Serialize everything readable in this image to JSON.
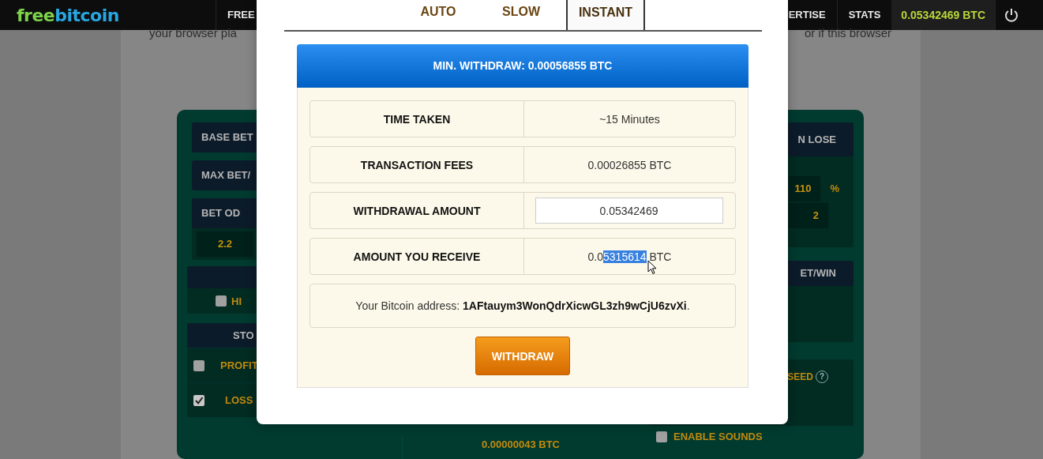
{
  "navbar": {
    "logo": [
      "free",
      "bitcoin"
    ],
    "left_links": [
      "FREE"
    ],
    "right_links": [
      "ERTISE",
      "STATS"
    ],
    "balance": "0.05342469 BTC"
  },
  "notice": [
    "your browser pla",
    "or if this browser"
  ],
  "panel": {
    "left": [
      {
        "kind": "header",
        "label": "BASE BET"
      },
      {
        "kind": "header",
        "label": "MAX BET/"
      },
      {
        "kind": "odds",
        "label": "BET OD",
        "value": "2.2"
      },
      {
        "kind": "choice",
        "options": [
          {
            "label": "HI",
            "checked": false
          }
        ]
      },
      {
        "kind": "stop",
        "label": "STO",
        "options": [
          {
            "label": "PROFIT",
            "checked": false
          },
          {
            "label": "LOSS",
            "checked": true
          }
        ]
      }
    ],
    "right": [
      {
        "kind": "on_lose",
        "label": "N LOSE",
        "fields": [
          {
            "value": "110",
            "unit": "%"
          },
          {
            "value": "2"
          }
        ]
      },
      {
        "kind": "section",
        "label": "ET/WIN"
      },
      {
        "kind": "seed",
        "label": "SEED",
        "help": "?"
      }
    ],
    "footer": {
      "amount": "0.00000043 BTC",
      "sounds": {
        "label": "ENABLE SOUNDS",
        "checked": false
      }
    }
  },
  "dialog": {
    "tabs": [
      {
        "label": "AUTO",
        "selected": false
      },
      {
        "label": "SLOW",
        "selected": false
      },
      {
        "label": "INSTANT",
        "selected": true
      }
    ],
    "header": "MIN. WITHDRAW: 0.00056855 BTC",
    "rows": [
      {
        "kind": "text",
        "label": "TIME TAKEN",
        "value": "~15 Minutes"
      },
      {
        "kind": "text",
        "label": "TRANSACTION FEES",
        "value": "0.00026855 BTC"
      },
      {
        "kind": "input",
        "label": "WITHDRAWAL AMOUNT",
        "value": "0.05342469"
      },
      {
        "kind": "selection",
        "label": "AMOUNT YOU RECEIVE",
        "value": "0.0",
        "selected_part": "5315614",
        "unit": "BTC"
      }
    ],
    "address": "Your Bitcoin address: **1AFtauym3WonQdrXicwGL3zh9wCjU6zvXi**.",
    "button": "WITHDRAW"
  }
}
